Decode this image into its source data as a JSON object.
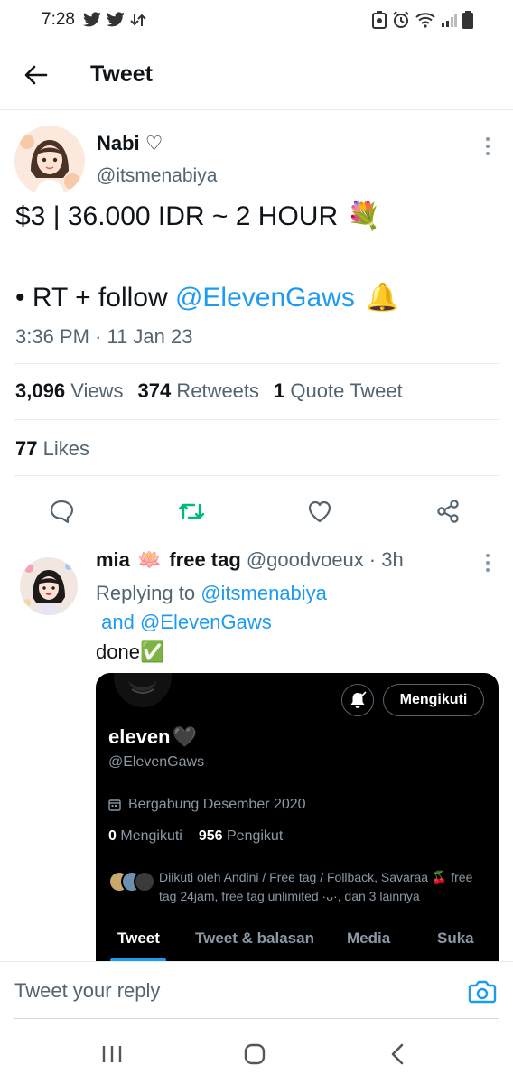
{
  "status_bar": {
    "time": "7:28"
  },
  "header": {
    "title": "Tweet"
  },
  "tweet": {
    "author_name": "Nabi ♡",
    "author_handle": "@itsmenabiya",
    "line1": "$3 | 36.000 IDR ~ 2 HOUR",
    "line1_emoji": "💐",
    "line2_prefix": "• RT + follow ",
    "line2_link": "@ElevenGaws",
    "line2_emoji": "🔔",
    "timestamp": "3:36 PM · 11 Jan 23",
    "views_count": "3,096",
    "views_label": "Views",
    "retweets_count": "374",
    "retweets_label": "Retweets",
    "quotes_count": "1",
    "quotes_label": "Quote Tweet",
    "likes_count": "77",
    "likes_label": "Likes"
  },
  "reply": {
    "name": "mia",
    "name_emoji": "🪷",
    "name_suffix": "free tag",
    "handle": "@goodvoeux",
    "time": "· 3h",
    "replying_prefix": "Replying to ",
    "replying_user1": "@itsmenabiya",
    "replying_and": " and ",
    "replying_user2": "@ElevenGaws",
    "text": "done",
    "text_emoji": "✅",
    "embed": {
      "follow_button": "Mengikuti",
      "name": "eleven",
      "name_emoji": "🖤",
      "handle": "@ElevenGaws",
      "joined": "Bergabung Desember 2020",
      "following_count": "0",
      "following_label": "Mengikuti",
      "followers_count": "956",
      "followers_label": "Pengikut",
      "followed_by": "Diikuti oleh Andini / Free tag / Follback, Savaraa 🍒 free tag 24jam, free tag unlimited ·ᴗ·, dan 3 lainnya",
      "tabs": [
        "Tweet",
        "Tweet & balasan",
        "Media",
        "Suka"
      ]
    }
  },
  "reply_bar": {
    "placeholder": "Tweet your reply"
  },
  "colors": {
    "accent": "#1d9bf0",
    "retweet_green": "#00ba7c",
    "secondary_text": "#536471"
  }
}
